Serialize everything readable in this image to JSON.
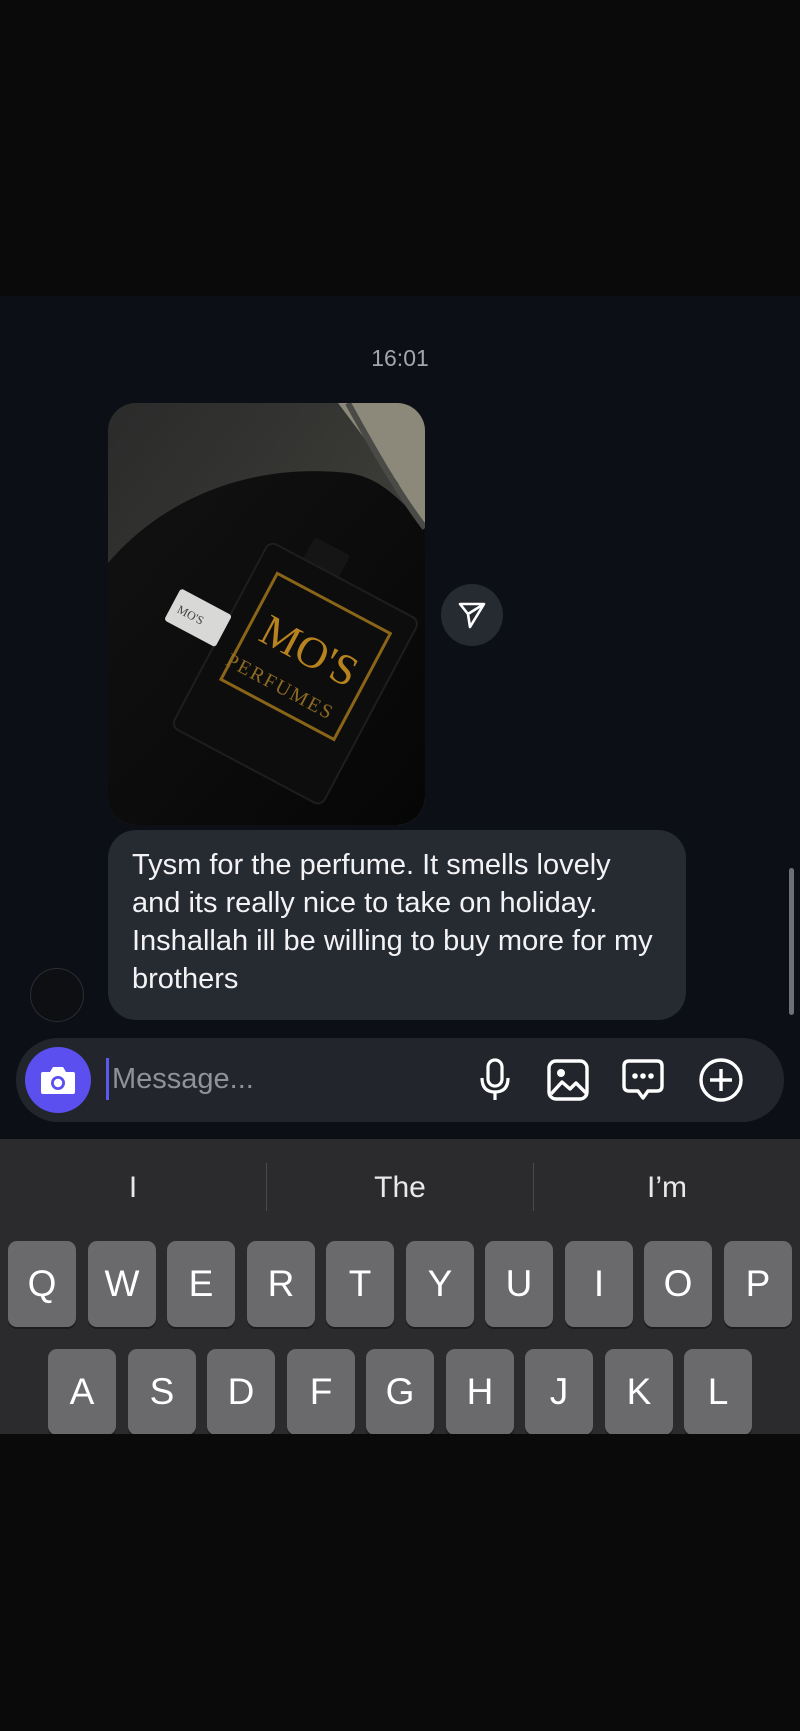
{
  "conversation": {
    "timestamp": "16:01",
    "photo_message": {
      "brand_line1": "MO'S",
      "brand_line2": "PERFUMES"
    },
    "text_message": "Tysm for the perfume. It smells lovely and its really nice to take on holiday. Inshallah ill be willing to buy more for my brothers"
  },
  "composer": {
    "placeholder": "Message...",
    "value": "",
    "icons": [
      "camera-icon",
      "microphone-icon",
      "gallery-icon",
      "sticker-icon",
      "plus-circle-icon"
    ]
  },
  "keyboard": {
    "suggestions": [
      "I",
      "The",
      "I’m"
    ],
    "row1": [
      "Q",
      "W",
      "E",
      "R",
      "T",
      "Y",
      "U",
      "I",
      "O",
      "P"
    ],
    "row2": [
      "A",
      "S",
      "D",
      "F",
      "G",
      "H",
      "J",
      "K",
      "L"
    ]
  },
  "colors": {
    "accent": "#5c4ff0",
    "chat_background": "#0c0f16",
    "bubble": "#262a31",
    "keyboard": "#2b2b2d",
    "key": "#6a6a6d"
  }
}
